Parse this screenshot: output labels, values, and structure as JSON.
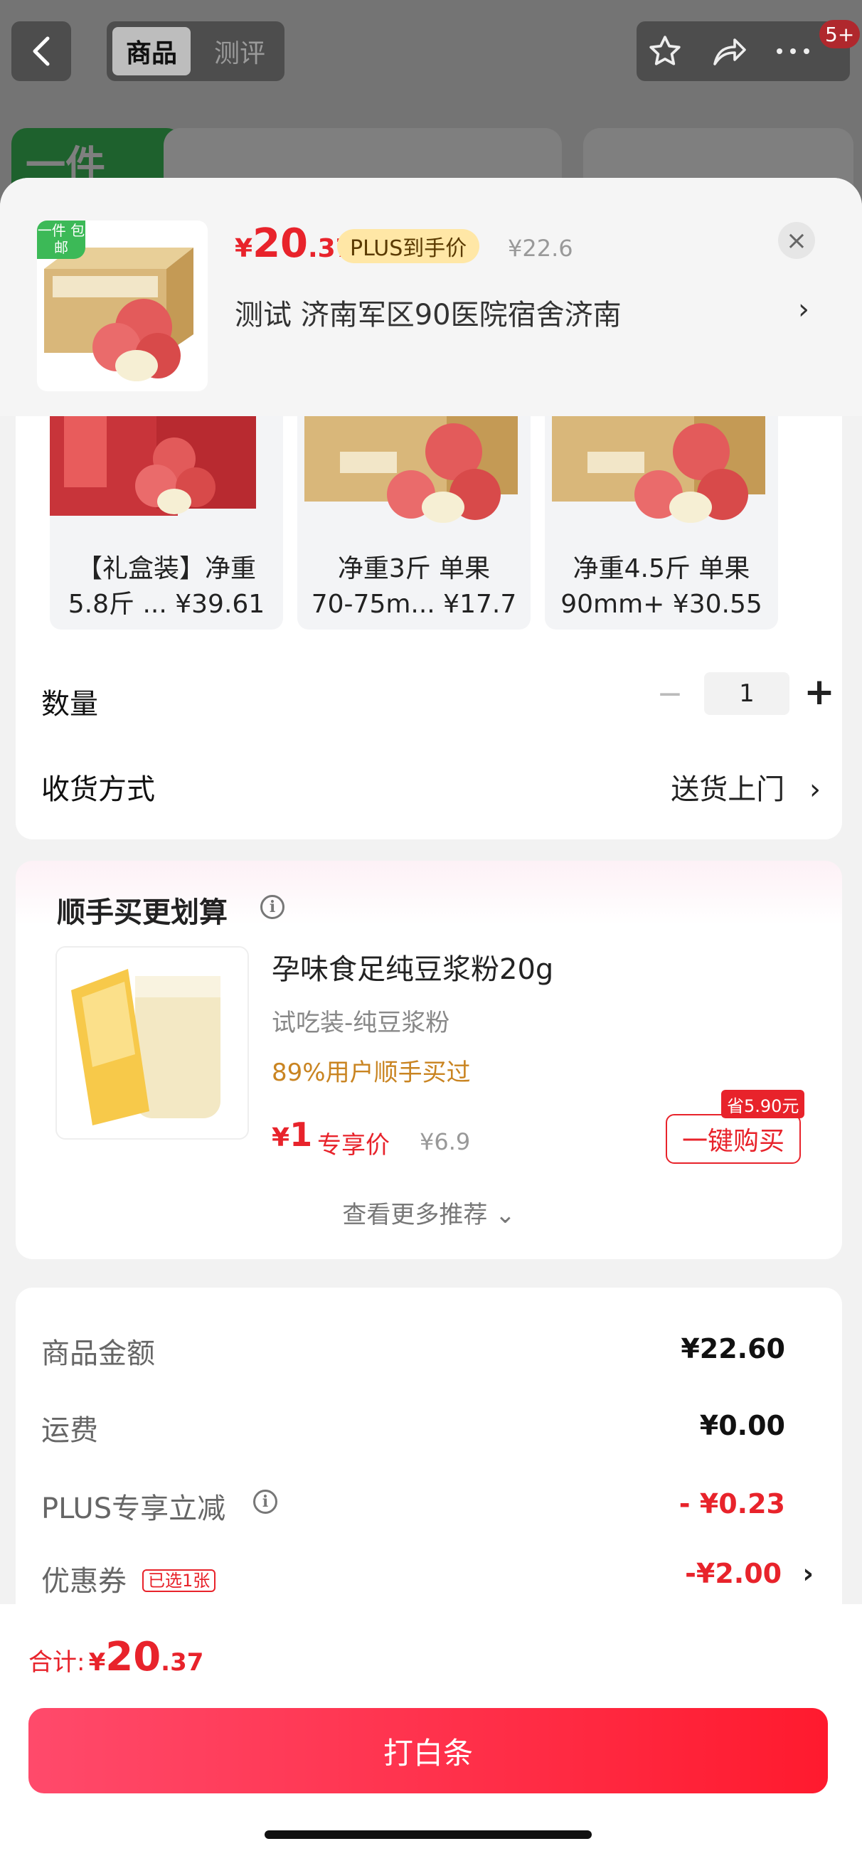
{
  "background_page": {
    "promo_text": "一件",
    "nav": {
      "back_icon": "chevron-left-icon",
      "tabs": [
        "商品",
        "测评"
      ],
      "active_tab": "商品",
      "icons": [
        "star-icon",
        "share-icon",
        "more-icon"
      ],
      "badge": "5+"
    }
  },
  "sheet": {
    "product": {
      "thumb_tag": "一件 包邮",
      "price_symbol": "¥",
      "price_int": "20",
      "price_dec": ".37",
      "plus_tag": "PLUS到手价",
      "original_price": "¥22.6",
      "address": "测试  济南军区90医院宿舍济南",
      "chevron": "›",
      "close": "×"
    },
    "variants": [
      {
        "line1": "【礼盒装】净重",
        "line2": "5.8斤 ... ¥39.61"
      },
      {
        "line1": "净重3斤 单果",
        "line2": "70-75m... ¥17.7"
      },
      {
        "line1": "净重4.5斤 单果",
        "line2": "90mm+ ¥30.55"
      }
    ],
    "quantity": {
      "label": "数量",
      "minus": "−",
      "value": "1",
      "plus": "+"
    },
    "delivery": {
      "label": "收货方式",
      "value": "送货上门",
      "chevron": "›"
    },
    "recommend": {
      "title": "顺手买更划算",
      "item_name": "孕味食足纯豆浆粉20g",
      "item_spec": "试吃装-纯豆浆粉",
      "bought_pct": "89%用户顺手买过",
      "price_symbol": "¥",
      "price": "1",
      "exclusive": "专享价",
      "original": "¥6.9",
      "save_tag": "省5.90元",
      "buy_button": "一键购买",
      "more": "查看更多推荐 ⌄"
    },
    "summary": {
      "goods_label": "商品金额",
      "goods_value": "¥22.60",
      "shipping_label": "运费",
      "shipping_value": "¥0.00",
      "plus_label": "PLUS专享立减",
      "plus_value": "- ¥0.23",
      "coupon_label": "优惠券",
      "coupon_tag": "已选1张",
      "coupon_value": "-¥2.00",
      "coupon_chevron": "›"
    },
    "footer": {
      "total_label": "合计:",
      "total_symbol": "¥",
      "total_int": "20",
      "total_dec": ".37",
      "pay_button": "打白条"
    }
  },
  "colors": {
    "accent_red": "#e8232b",
    "plus_gold": "#ffe7a6",
    "green_tag": "#3cb957"
  }
}
